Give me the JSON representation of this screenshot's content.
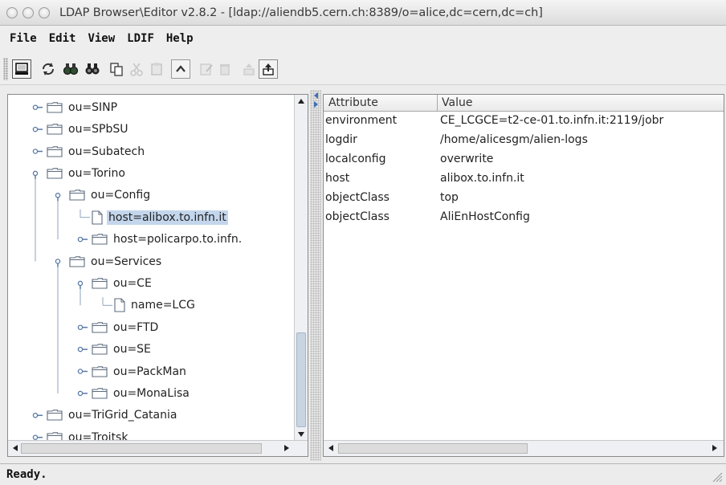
{
  "window": {
    "title": "LDAP Browser\\Editor v2.8.2 - [ldap://aliendb5.cern.ch:8389/o=alice,dc=cern,dc=ch]"
  },
  "menu": {
    "file": "File",
    "edit": "Edit",
    "view": "View",
    "ldif": "LDIF",
    "help": "Help"
  },
  "tree": {
    "items": [
      {
        "label": "ou=SINP",
        "type": "folder",
        "depth": 0,
        "expanded": false
      },
      {
        "label": "ou=SPbSU",
        "type": "folder",
        "depth": 0,
        "expanded": false
      },
      {
        "label": "ou=Subatech",
        "type": "folder",
        "depth": 0,
        "expanded": false
      },
      {
        "label": "ou=Torino",
        "type": "folder",
        "depth": 0,
        "expanded": true
      },
      {
        "label": "ou=Config",
        "type": "folder",
        "depth": 1,
        "expanded": true
      },
      {
        "label": "host=alibox.to.infn.it",
        "type": "file",
        "depth": 2,
        "selected": true
      },
      {
        "label": "host=policarpo.to.infn.",
        "type": "folder",
        "depth": 2,
        "expanded": false
      },
      {
        "label": "ou=Services",
        "type": "folder",
        "depth": 1,
        "expanded": true
      },
      {
        "label": "ou=CE",
        "type": "folder",
        "depth": 2,
        "expanded": true
      },
      {
        "label": "name=LCG",
        "type": "file",
        "depth": 3
      },
      {
        "label": "ou=FTD",
        "type": "folder",
        "depth": 2,
        "expanded": false
      },
      {
        "label": "ou=SE",
        "type": "folder",
        "depth": 2,
        "expanded": false
      },
      {
        "label": "ou=PackMan",
        "type": "folder",
        "depth": 2,
        "expanded": false
      },
      {
        "label": "ou=MonaLisa",
        "type": "folder",
        "depth": 2,
        "expanded": false
      },
      {
        "label": "ou=TriGrid_Catania",
        "type": "folder",
        "depth": 0,
        "expanded": false
      },
      {
        "label": "ou=Troitsk",
        "type": "folder",
        "depth": 0,
        "expanded": false
      }
    ]
  },
  "attributes": {
    "headers": {
      "attribute": "Attribute",
      "value": "Value"
    },
    "rows": [
      {
        "attribute": "environment",
        "value": "CE_LCGCE=t2-ce-01.to.infn.it:2119/jobr"
      },
      {
        "attribute": "logdir",
        "value": "/home/alicesgm/alien-logs"
      },
      {
        "attribute": "localconfig",
        "value": "overwrite"
      },
      {
        "attribute": "host",
        "value": "alibox.to.infn.it"
      },
      {
        "attribute": "objectClass",
        "value": "top"
      },
      {
        "attribute": "objectClass",
        "value": "AliEnHostConfig"
      }
    ]
  },
  "status": {
    "text": "Ready."
  },
  "colors": {
    "selection": "#c3d6ec",
    "tree_line": "#8fa3bd"
  }
}
